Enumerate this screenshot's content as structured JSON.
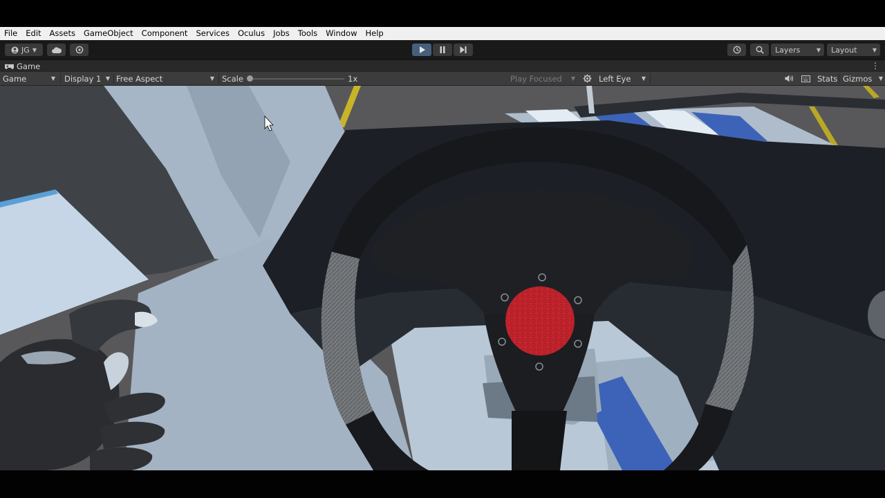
{
  "menu": [
    "File",
    "Edit",
    "Assets",
    "GameObject",
    "Component",
    "Services",
    "Oculus",
    "Jobs",
    "Tools",
    "Window",
    "Help"
  ],
  "toolbar": {
    "account_label": "JG",
    "account_icon": "account-icon",
    "cloud_icon": "cloud-icon",
    "collab_icon": "collab-icon",
    "play_icon": "play-icon",
    "pause_icon": "pause-icon",
    "step_icon": "step-icon",
    "history_icon": "history-icon",
    "search_icon": "search-icon",
    "layers_label": "Layers",
    "layout_label": "Layout",
    "play_active_color": "#46607c"
  },
  "tab": {
    "title": "Game",
    "icon": "game-controller-icon"
  },
  "gamebar": {
    "view_mode": "Game",
    "display": "Display 1",
    "aspect": "Free Aspect",
    "scale_label": "Scale",
    "scale_value": "1x",
    "play_focused": "Play Focused",
    "eye": "Left Eye",
    "stats": "Stats",
    "gizmos": "Gizmos",
    "audio_icon": "speaker-icon",
    "stats_icon": "keyboard-icon",
    "vr_icon": "vr-icon"
  },
  "scene": {
    "wheel_hub_color": "#c4242d",
    "wheel_grip_color": "#7a7a7a",
    "dashboard_color": "#1c2026",
    "stripe_color": "#3d63b8"
  }
}
